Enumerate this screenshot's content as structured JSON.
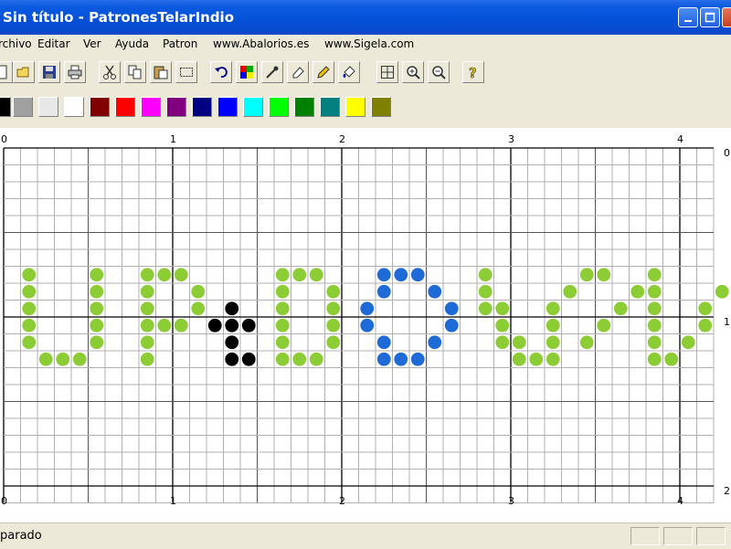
{
  "window": {
    "title": "Sin título - PatronesTelarIndio"
  },
  "menu": [
    "rchivo",
    "Editar",
    "Ver",
    "Ayuda",
    "Patron",
    "www.Abalorios.es",
    "www.Sigela.com"
  ],
  "toolbar_icons": [
    "new-icon",
    "open-icon",
    "save-icon",
    "print-icon",
    "cut-icon",
    "copy-icon",
    "paste-icon",
    "select-icon",
    "undo-icon",
    "color-picker-icon",
    "eyedropper-icon",
    "eraser-icon",
    "pencil-icon",
    "fill-icon",
    "grid-icon",
    "zoom-in-icon",
    "zoom-out-icon",
    "help-icon"
  ],
  "palette": [
    "#000000",
    "#a0a0a0",
    "#e8e8e8",
    "#ffffff",
    "#800000",
    "#ff0000",
    "#ff00ff",
    "#800080",
    "#000080",
    "#0000ff",
    "#00ffff",
    "#00ff00",
    "#008000",
    "#008080",
    "#ffff00",
    "#808000"
  ],
  "ruler": {
    "top": [
      "0",
      "1",
      "2",
      "3",
      "4"
    ],
    "bottom": [
      "0",
      "1",
      "2",
      "3",
      "4"
    ],
    "right": [
      "0",
      "1",
      "2"
    ]
  },
  "beads": {
    "green": "#8ccc34",
    "black": "#000000",
    "blue": "#1e6ad6",
    "pattern": [
      "................................................................................",
      "................................................................................",
      "................................................................................",
      "................................................................................",
      "................................................................................",
      "................................................................................",
      "................................................................................",
      ".G...G..GGG.....GGG...BBB...G.....GG..G....G",
      ".G...G..G..G....G..G..B..B..G....G...GG...G",
      ".G...G..G..G.K..G..G.B....B.GG..G...G.G..G",
      ".G...G..GGG.KKK.G..G.B....B..G..G..G..G..G",
      ".G...G..G....K..G..G..B..B...GG.G.G...G.G",
      "..GGG...G....KK.GGG...BBB.....GGG.....GG"
    ]
  },
  "status": {
    "text": "parado"
  }
}
